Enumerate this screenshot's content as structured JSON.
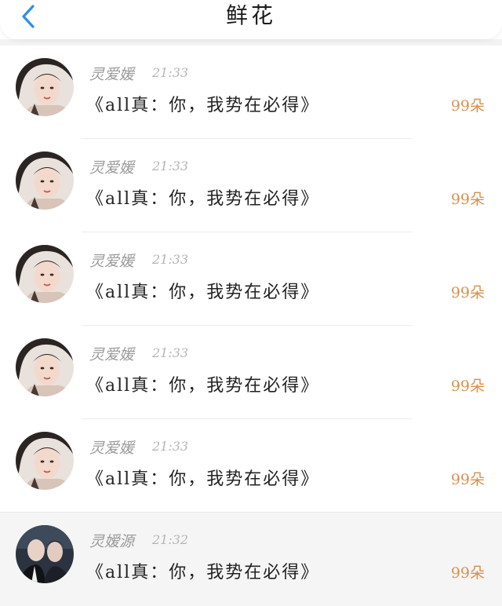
{
  "header": {
    "title": "鲜花",
    "back_icon": "chevron-left-icon",
    "accent": "#2f8ee5"
  },
  "items": [
    {
      "name": "灵爱媛",
      "time": "21:33",
      "message": "《all真：你，我势在必得》",
      "count": "99朵",
      "avatar": "portrait-woman"
    },
    {
      "name": "灵爱媛",
      "time": "21:33",
      "message": "《all真：你，我势在必得》",
      "count": "99朵",
      "avatar": "portrait-woman"
    },
    {
      "name": "灵爱媛",
      "time": "21:33",
      "message": "《all真：你，我势在必得》",
      "count": "99朵",
      "avatar": "portrait-woman"
    },
    {
      "name": "灵爱媛",
      "time": "21:33",
      "message": "《all真：你，我势在必得》",
      "count": "99朵",
      "avatar": "portrait-woman"
    },
    {
      "name": "灵爱媛",
      "time": "21:33",
      "message": "《all真：你，我势在必得》",
      "count": "99朵",
      "avatar": "portrait-woman"
    },
    {
      "name": "灵嫒源",
      "time": "21:32",
      "message": "《all真：你，我势在必得》",
      "count": "99朵",
      "avatar": "portrait-two-men"
    }
  ],
  "colors": {
    "count": "#d9904c",
    "name": "#9a9a9a",
    "time": "#b5b5b5"
  }
}
